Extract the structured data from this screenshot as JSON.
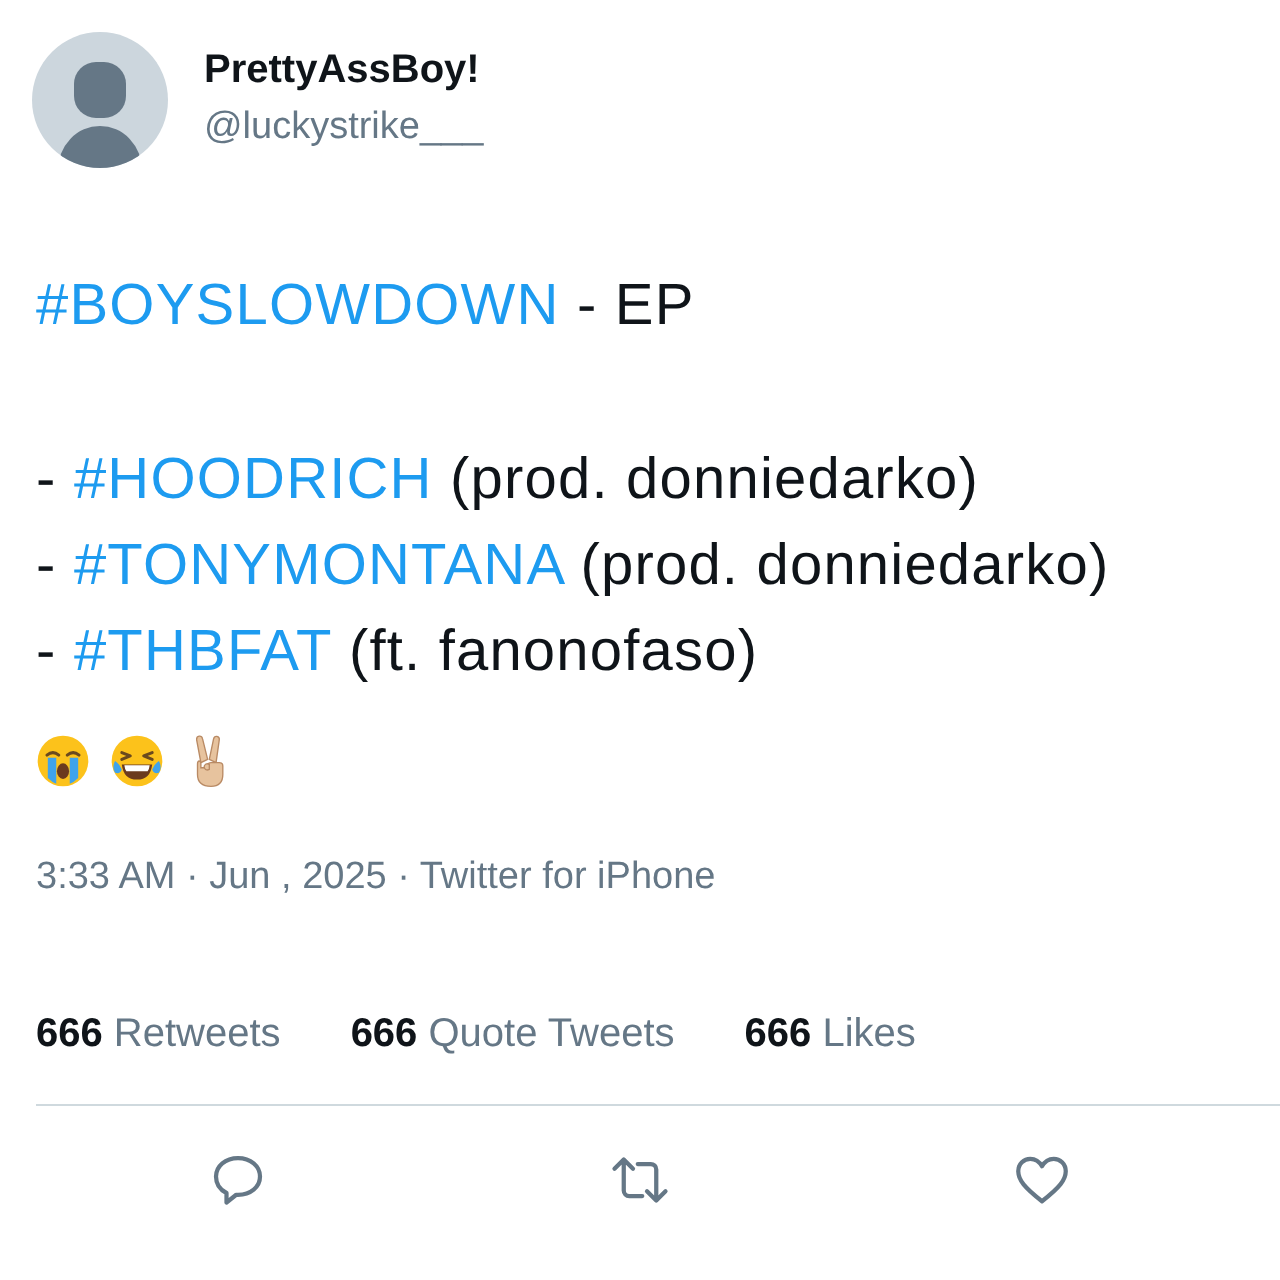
{
  "author": {
    "name": "PrettyAssBoy!",
    "handle": "@luckystrike___"
  },
  "tweet": {
    "title": {
      "hashtag": "#BOYSLOWDOWN",
      "text": "- EP"
    },
    "tracks": [
      {
        "bullet": "-",
        "hashtag": "#HOODRICH",
        "credit": "(prod. donniedarko)"
      },
      {
        "bullet": "-",
        "hashtag": "#TONYMONTANA",
        "credit": "(prod. donniedarko)"
      },
      {
        "bullet": "-",
        "hashtag": "#THBFAT",
        "credit": "(ft. fanonofaso)"
      }
    ],
    "timestamp": "3:33 AM · Jun , 2025 · Twitter for iPhone"
  },
  "stats": [
    {
      "count": "666",
      "label": "Retweets"
    },
    {
      "count": "666",
      "label": "Quote Tweets"
    },
    {
      "count": "666",
      "label": "Likes"
    }
  ]
}
